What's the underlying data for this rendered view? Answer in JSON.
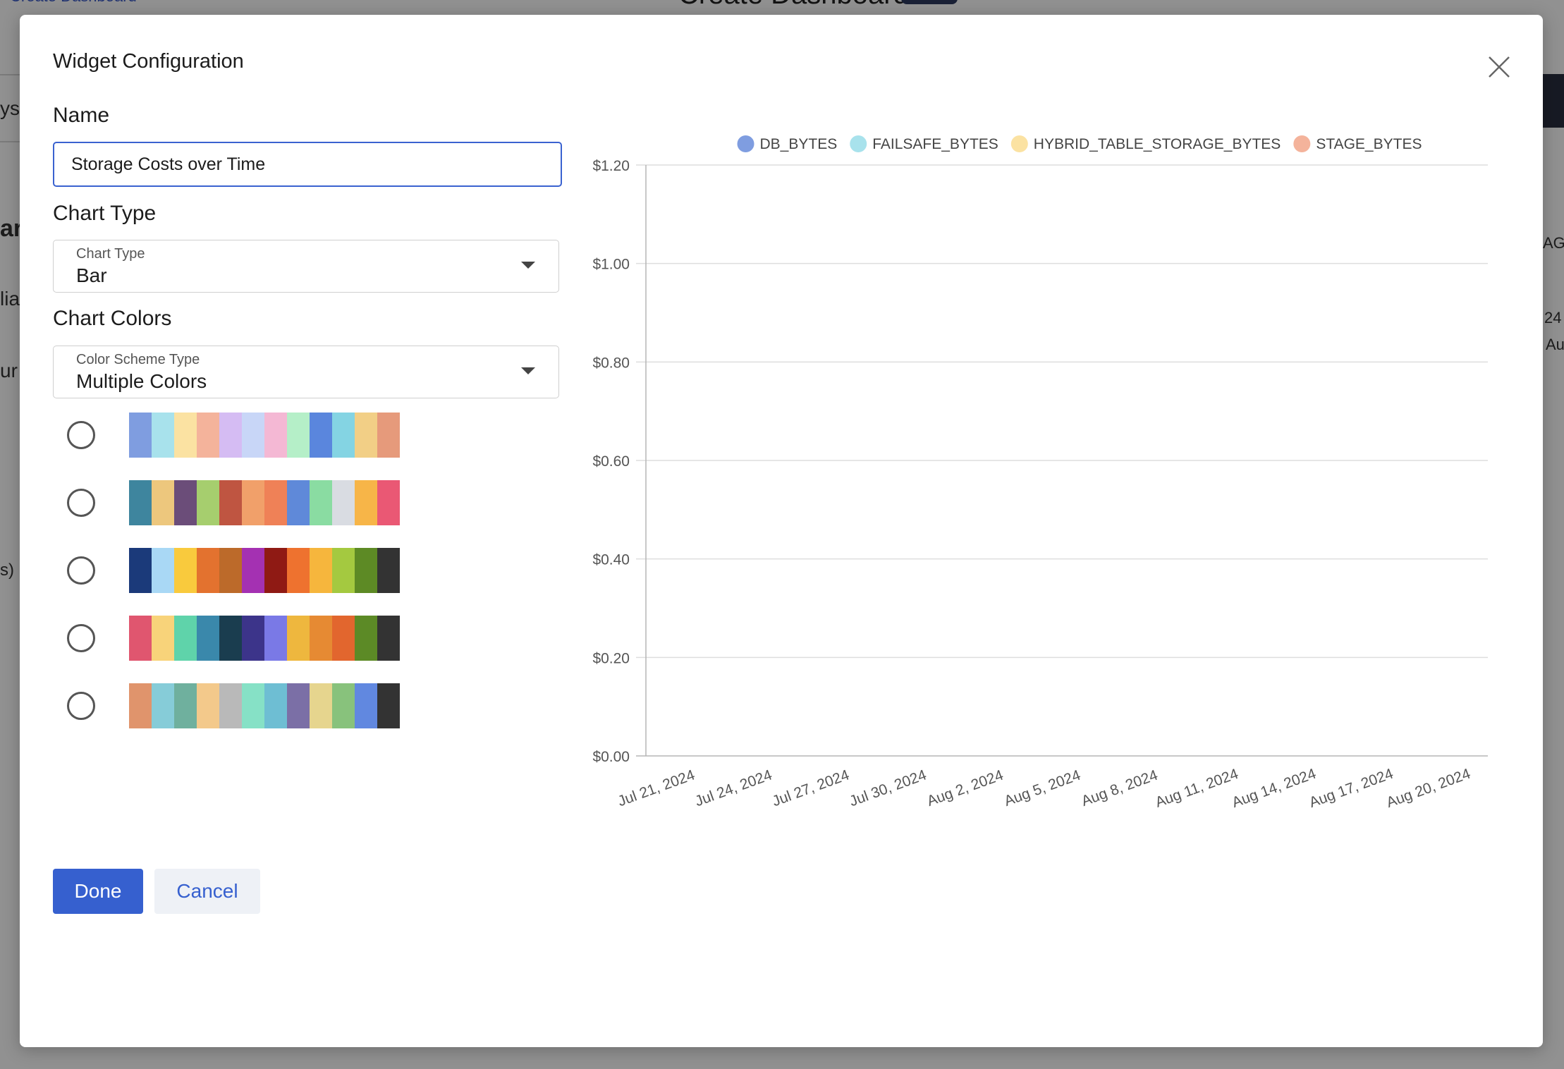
{
  "background": {
    "page_title": "Create Dashboard",
    "back_link": "Create Dashboard",
    "fragments": [
      "ys",
      "ar",
      "lia",
      "ur",
      "s)",
      "AG",
      "24",
      "Au"
    ]
  },
  "modal": {
    "title": "Widget Configuration",
    "name_label": "Name",
    "name_value": "Storage Costs over Time",
    "chart_type_label": "Chart Type",
    "chart_type_select": {
      "float_label": "Chart Type",
      "value": "Bar"
    },
    "chart_colors_label": "Chart Colors",
    "color_scheme_select": {
      "float_label": "Color Scheme Type",
      "value": "Multiple Colors"
    },
    "palettes": [
      [
        "#7f9de0",
        "#a8e2ec",
        "#fbe2a2",
        "#f4b39b",
        "#d5bcf3",
        "#c8d6f7",
        "#f4b8d4",
        "#b5efc8",
        "#5a86dd",
        "#84d4e3",
        "#f2cf86",
        "#e69a7b"
      ],
      [
        "#3e859e",
        "#edc77d",
        "#6b4d79",
        "#a6ce6e",
        "#bf5541",
        "#f1a06a",
        "#ef8157",
        "#5f89d9",
        "#8adca2",
        "#d9dce2",
        "#f7b548",
        "#ea5874"
      ],
      [
        "#1b3a7a",
        "#a9d8f5",
        "#f9ca3d",
        "#e3722f",
        "#bc6a2a",
        "#a431b2",
        "#8f1a14",
        "#ee722f",
        "#f6b63d",
        "#a4c940",
        "#5d8a25",
        "#333333"
      ],
      [
        "#e0566f",
        "#f8d37a",
        "#5fd3aa",
        "#3a88ab",
        "#1a3d4f",
        "#3c348a",
        "#7a79e6",
        "#eeb73e",
        "#e68a33",
        "#e2662e",
        "#5c8a26",
        "#333333"
      ],
      [
        "#e0946c",
        "#86ccd8",
        "#6fb09e",
        "#f3c98b",
        "#b9b9b9",
        "#86e1c6",
        "#6ebed3",
        "#7b6fa6",
        "#e6d58e",
        "#88c27c",
        "#6188e0",
        "#333333"
      ]
    ],
    "done_label": "Done",
    "cancel_label": "Cancel"
  },
  "chart_data": {
    "type": "bar",
    "series": [
      {
        "name": "DB_BYTES",
        "color": "#7f9de0",
        "values": []
      },
      {
        "name": "FAILSAFE_BYTES",
        "color": "#a8e2ec",
        "values": []
      },
      {
        "name": "HYBRID_TABLE_STORAGE_BYTES",
        "color": "#fbe2a2",
        "values": []
      },
      {
        "name": "STAGE_BYTES",
        "color": "#f4b39b",
        "values": []
      }
    ],
    "y_ticks": [
      "$0.00",
      "$0.20",
      "$0.40",
      "$0.60",
      "$0.80",
      "$1.00",
      "$1.20"
    ],
    "ylim": [
      0,
      1.2
    ],
    "x_ticks": [
      "Jul 21, 2024",
      "Jul 24, 2024",
      "Jul 27, 2024",
      "Jul 30, 2024",
      "Aug 2, 2024",
      "Aug 5, 2024",
      "Aug 8, 2024",
      "Aug 11, 2024",
      "Aug 14, 2024",
      "Aug 17, 2024",
      "Aug 20, 2024"
    ],
    "legend_position": "top",
    "grid": true
  }
}
